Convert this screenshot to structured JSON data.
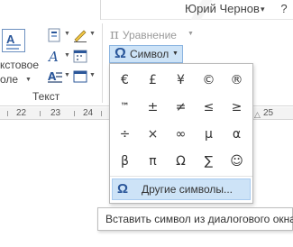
{
  "titlebar": {
    "user_name": "Юрий Чернов",
    "help": "?"
  },
  "ribbon": {
    "textbox_label_line1": "кстовое",
    "textbox_label_line2": "оле",
    "group_label": "Текст",
    "equation_label": "Уравнение",
    "symbol_label": "Символ"
  },
  "ruler": {
    "numbers": [
      "22",
      "23",
      "24",
      "25"
    ]
  },
  "symbols": {
    "cells": [
      "€",
      "£",
      "¥",
      "©",
      "®",
      "™",
      "±",
      "≠",
      "≤",
      "≥",
      "÷",
      "×",
      "∞",
      "µ",
      "α",
      "β",
      "π",
      "Ω",
      "∑",
      "☺"
    ],
    "more_label": "Другие символы..."
  },
  "tooltip": {
    "text": "Вставить символ из диалогового окна"
  },
  "colors": {
    "accent": "#2b579a",
    "hover": "#cde3f7",
    "hover_border": "#8ab4e0"
  }
}
